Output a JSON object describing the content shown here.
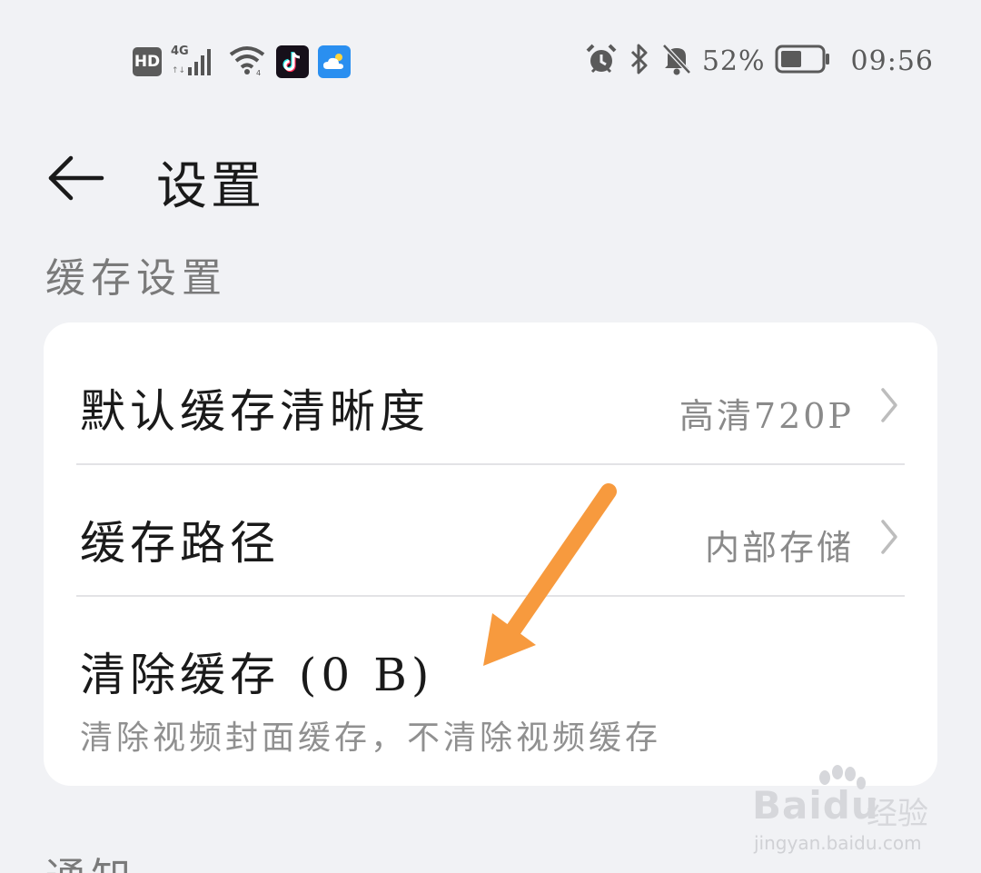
{
  "status_bar": {
    "left_icons": [
      "hd-icon",
      "signal-4g-icon",
      "wifi-icon",
      "tiktok-app-icon",
      "weather-app-icon"
    ],
    "hd_label": "HD",
    "network_label": "4G",
    "battery_percent": "52%",
    "battery_level": 0.52,
    "time": "09:56",
    "right_icons": [
      "alarm-icon",
      "bluetooth-icon",
      "mute-notification-icon",
      "battery-icon"
    ]
  },
  "header": {
    "back_icon": "arrow-left-icon",
    "title": "设置"
  },
  "cache_section": {
    "title": "缓存设置",
    "items": [
      {
        "label": "默认缓存清晰度",
        "value": "高清720P",
        "chevron": "chevron-right-icon"
      },
      {
        "label": "缓存路径",
        "value": "内部存储",
        "chevron": "chevron-right-icon"
      },
      {
        "label": "清除缓存 (0 B)",
        "subtitle": "清除视频封面缓存，不清除视频缓存"
      }
    ]
  },
  "next_section": {
    "title": "通知"
  },
  "annotation": {
    "arrow_color": "#f79a3e"
  },
  "watermark": {
    "logo": "Baidu",
    "cn": "经验",
    "url": "jingyan.baidu.com"
  },
  "colors": {
    "background": "#f1f2f5",
    "card": "#ffffff",
    "primary_text": "#1a1a1a",
    "secondary_text": "#8a8a8a"
  }
}
